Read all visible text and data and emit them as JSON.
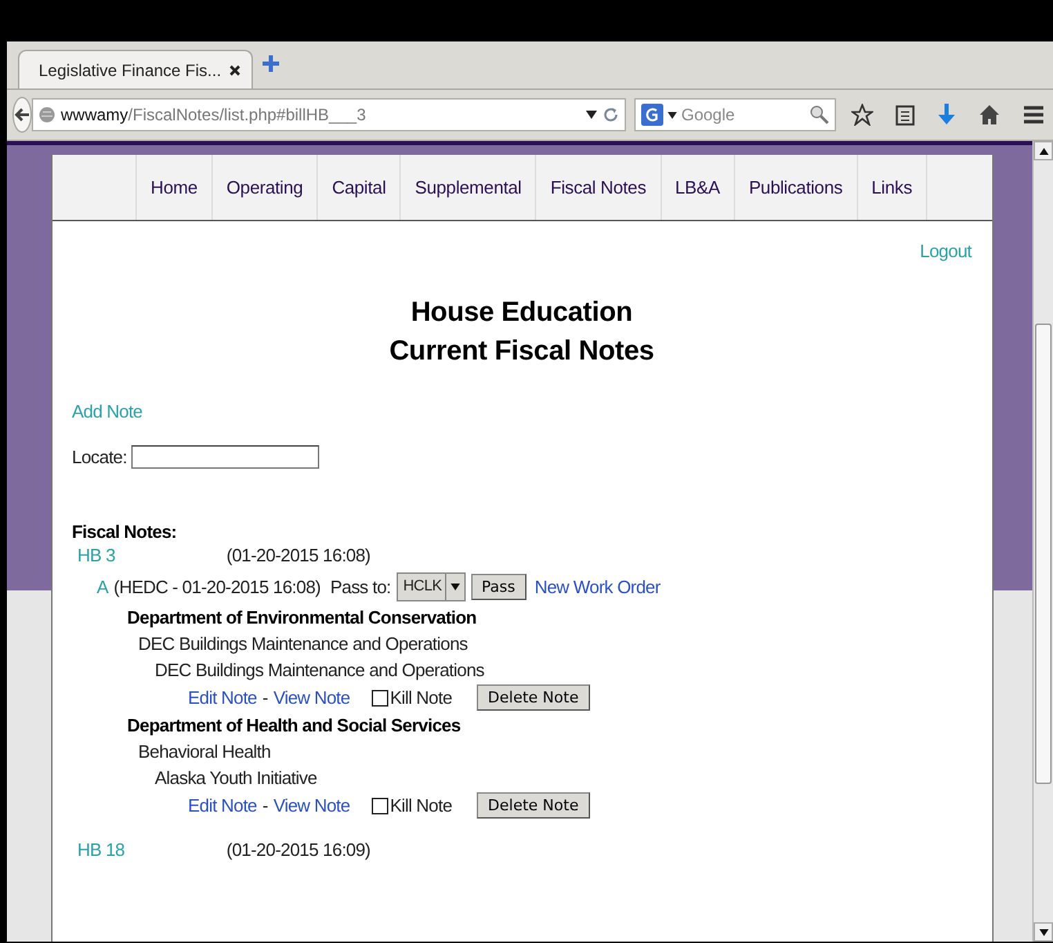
{
  "browser": {
    "tab_title": "Legislative Finance Fis...",
    "url_host": "wwwamy",
    "url_path": "/FiscalNotes/list.php#billHB___3",
    "search": {
      "placeholder": "Google"
    }
  },
  "nav": [
    {
      "label": "Home"
    },
    {
      "label": "Operating"
    },
    {
      "label": "Capital"
    },
    {
      "label": "Supplemental"
    },
    {
      "label": "Fiscal Notes"
    },
    {
      "label": "LB&A"
    },
    {
      "label": "Publications"
    },
    {
      "label": "Links"
    }
  ],
  "logout": "Logout",
  "heading": [
    "House Education",
    "Current Fiscal Notes"
  ],
  "add_note": "Add Note",
  "locate": {
    "label": "Locate:"
  },
  "section_title": "Fiscal Notes:",
  "bills": [
    {
      "bill": "HB 3",
      "date": "(01-20-2015 16:08)",
      "versions": [
        {
          "version": "A",
          "info": "(HEDC - 01-20-2015 16:08)",
          "pass_label": "Pass to:",
          "pass_select": "HCLK",
          "pass_button": "Pass",
          "work_order": "New Work Order",
          "departments": [
            {
              "name": "Department of Environmental Conservation",
              "allocation": "DEC Buildings Maintenance and Operations",
              "component": "DEC Buildings Maintenance and Operations",
              "edit": "Edit Note",
              "separator": "-",
              "view": "View Note",
              "kill_label": "Kill Note",
              "kill_checked": false,
              "delete": "Delete Note"
            },
            {
              "name": "Department of Health and Social Services",
              "allocation": "Behavioral Health",
              "component": "Alaska Youth Initiative",
              "edit": "Edit Note",
              "separator": "-",
              "view": "View Note",
              "kill_label": "Kill Note",
              "kill_checked": false,
              "delete": "Delete Note"
            }
          ]
        }
      ]
    },
    {
      "bill": "HB 18",
      "date": "(01-20-2015 16:09)"
    }
  ]
}
